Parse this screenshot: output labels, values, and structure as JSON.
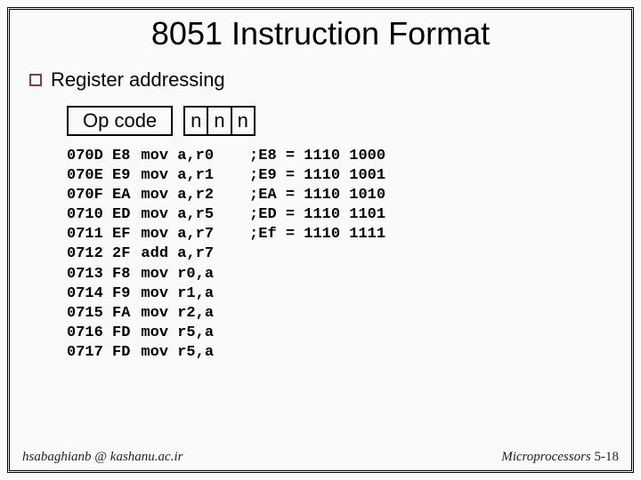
{
  "title": "8051 Instruction Format",
  "bullet": "Register addressing",
  "opcode_label": "Op code",
  "n_cells": [
    "n",
    "n",
    "n"
  ],
  "listing": {
    "addr_opcode": [
      "070D E8",
      "070E E9",
      "070F EA",
      "0710 ED",
      "0711 EF",
      "0712 2F",
      "0713 F8",
      "0714 F9",
      "0715 FA",
      "0716 FD",
      "0717 FD"
    ],
    "mnem": [
      "mov a,r0",
      "mov a,r1",
      "mov a,r2",
      "mov a,r5",
      "mov a,r7",
      "add a,r7",
      "mov r0,a",
      "mov r1,a",
      "mov r2,a",
      "mov r5,a",
      "mov r5,a"
    ],
    "decode": [
      ";E8 = 1110 1000",
      ";E9 = 1110 1001",
      ";EA = 1110 1010",
      ";ED = 1110 1101",
      ";Ef = 1110 1111"
    ]
  },
  "footer_left": "hsabaghianb @ kashanu.ac.ir",
  "footer_right_prefix": "Microprocessors ",
  "footer_right_page": "5-18"
}
